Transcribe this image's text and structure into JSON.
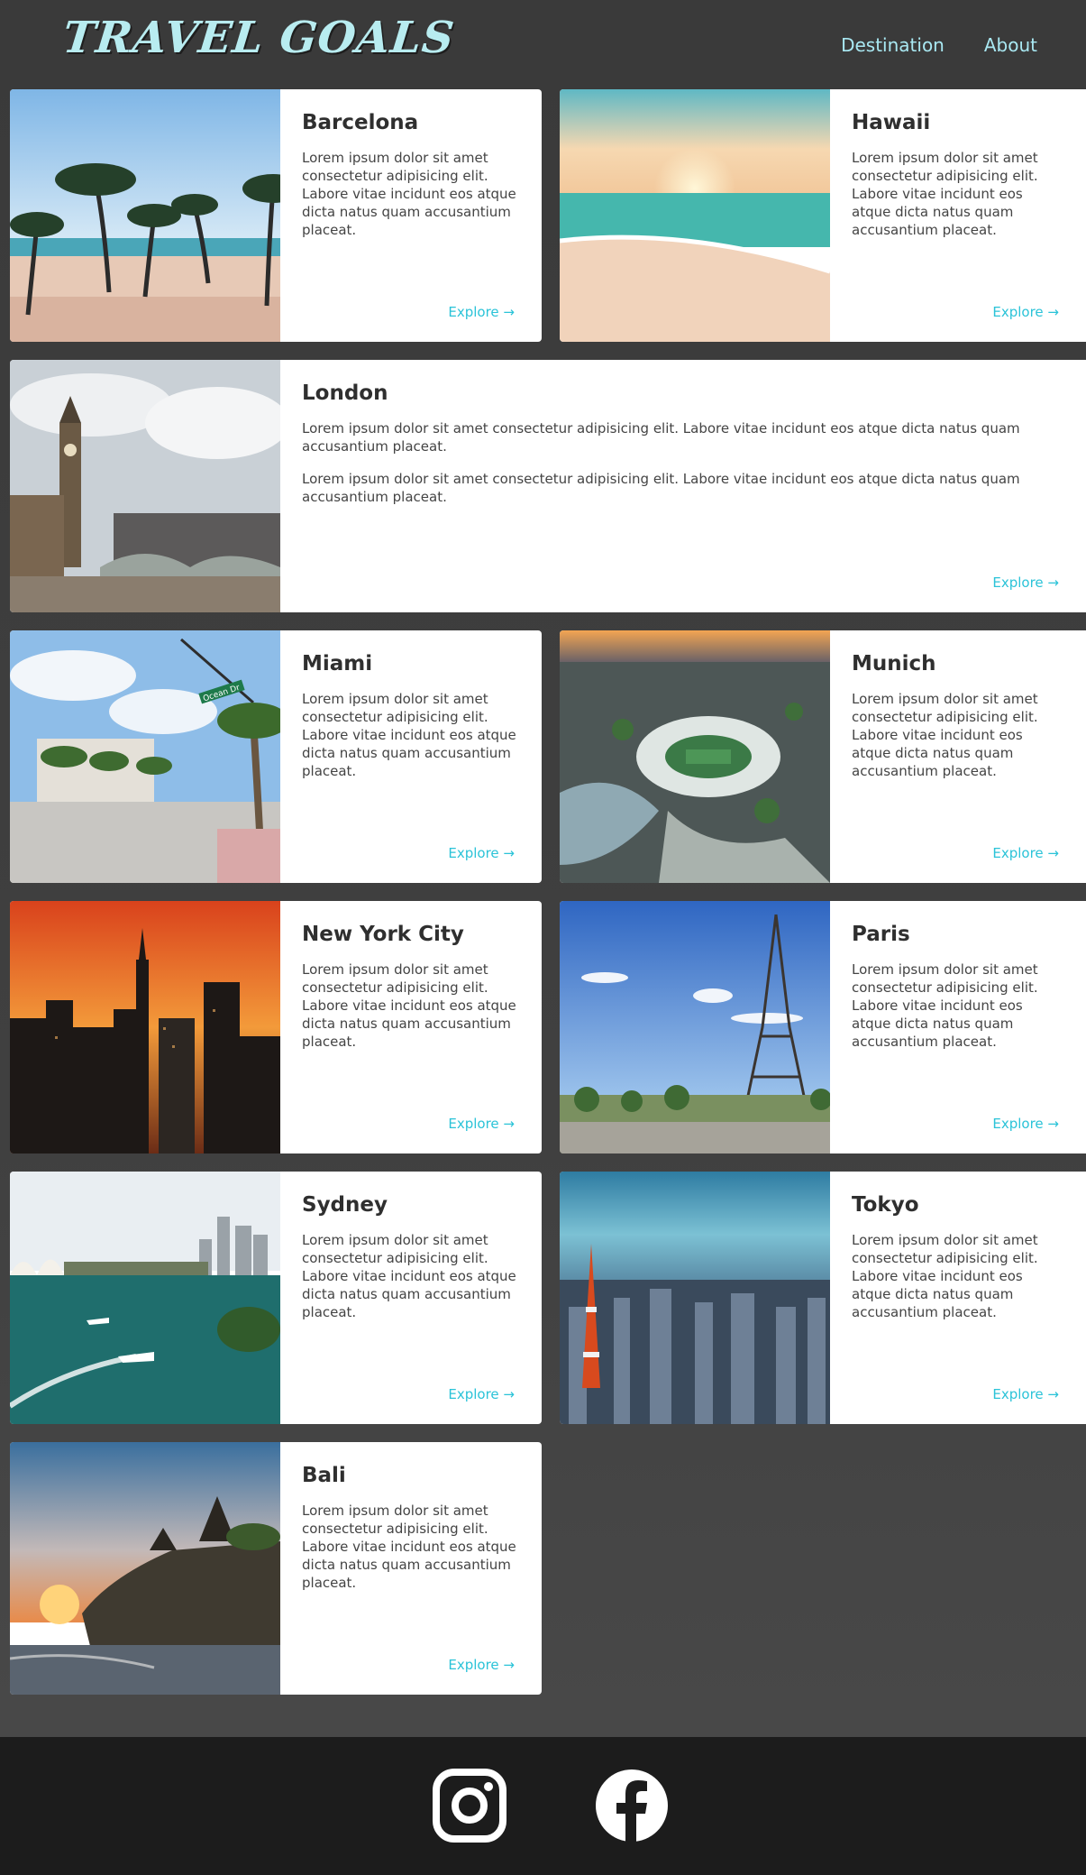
{
  "header": {
    "logo": "TRAVEL GOALS",
    "nav": [
      {
        "label": "Destination"
      },
      {
        "label": "About"
      }
    ]
  },
  "cards": [
    {
      "title": "Barcelona",
      "text": "Lorem ipsum dolor sit amet consectetur adipisicing elit. Labore vitae incidunt eos atque dicta natus quam accusantium placeat.",
      "link": "Explore →"
    },
    {
      "title": "Hawaii",
      "text": "Lorem ipsum dolor sit amet consectetur adipisicing elit. Labore vitae incidunt eos atque dicta natus quam accusantium placeat.",
      "link": "Explore →"
    },
    {
      "title": "London",
      "text": "Lorem ipsum dolor sit amet consectetur adipisicing elit. Labore vitae incidunt eos atque dicta natus quam accusantium placeat.",
      "text2": "Lorem ipsum dolor sit amet consectetur adipisicing elit. Labore vitae incidunt eos atque dicta natus quam accusantium placeat.",
      "link": "Explore →"
    },
    {
      "title": "Miami",
      "text": "Lorem ipsum dolor sit amet consectetur adipisicing elit. Labore vitae incidunt eos atque dicta natus quam accusantium placeat.",
      "link": "Explore →",
      "sign": "Ocean Dr"
    },
    {
      "title": "Munich",
      "text": "Lorem ipsum dolor sit amet consectetur adipisicing elit. Labore vitae incidunt eos atque dicta natus quam accusantium placeat.",
      "link": "Explore →"
    },
    {
      "title": "New York City",
      "text": "Lorem ipsum dolor sit amet consectetur adipisicing elit. Labore vitae incidunt eos atque dicta natus quam accusantium placeat.",
      "link": "Explore →"
    },
    {
      "title": "Paris",
      "text": "Lorem ipsum dolor sit amet consectetur adipisicing elit. Labore vitae incidunt eos atque dicta natus quam accusantium placeat.",
      "link": "Explore →"
    },
    {
      "title": "Sydney",
      "text": "Lorem ipsum dolor sit amet consectetur adipisicing elit. Labore vitae incidunt eos atque dicta natus quam accusantium placeat.",
      "link": "Explore →"
    },
    {
      "title": "Tokyo",
      "text": "Lorem ipsum dolor sit amet consectetur adipisicing elit. Labore vitae incidunt eos atque dicta natus quam accusantium placeat.",
      "link": "Explore →"
    },
    {
      "title": "Bali",
      "text": "Lorem ipsum dolor sit amet consectetur adipisicing elit. Labore vitae incidunt eos atque dicta natus quam accusantium placeat.",
      "link": "Explore →"
    }
  ],
  "footer": {
    "icons": [
      "instagram-icon",
      "facebook-icon"
    ]
  },
  "colors": {
    "accent": "#2bc3d8",
    "logo": "#b8ecf0",
    "background": "#3a3a3a",
    "footer": "#1c1c1c"
  }
}
